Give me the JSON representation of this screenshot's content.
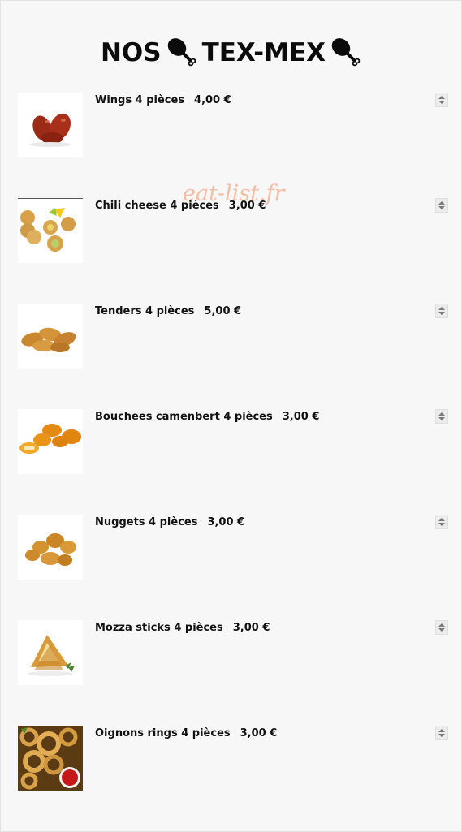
{
  "header": {
    "title_left": "NOS",
    "title_right": "TEX-MEX",
    "title_icon": "drumstick-icon"
  },
  "watermark": "eat-list.fr",
  "items": [
    {
      "name": "Wings 4 pièces",
      "price": "4,00 €",
      "image": "wings-image"
    },
    {
      "name": "Chili cheese 4 pièces",
      "price": "3,00 €",
      "image": "chili-cheese-image"
    },
    {
      "name": "Tenders 4 pièces",
      "price": "5,00 €",
      "image": "tenders-image"
    },
    {
      "name": "Bouchees camenbert 4 pièces",
      "price": "3,00 €",
      "image": "camembert-bites-image"
    },
    {
      "name": "Nuggets 4 pièces",
      "price": "3,00 €",
      "image": "nuggets-image"
    },
    {
      "name": "Mozza sticks 4 pièces",
      "price": "3,00 €",
      "image": "mozza-sticks-image"
    },
    {
      "name": "Oignons rings 4 pièces",
      "price": "3,00 €",
      "image": "onion-rings-image"
    }
  ],
  "colors": {
    "background": "#f7f7f7",
    "text": "#111111",
    "watermark": "#f3b89c",
    "stepper": "#ececec"
  }
}
